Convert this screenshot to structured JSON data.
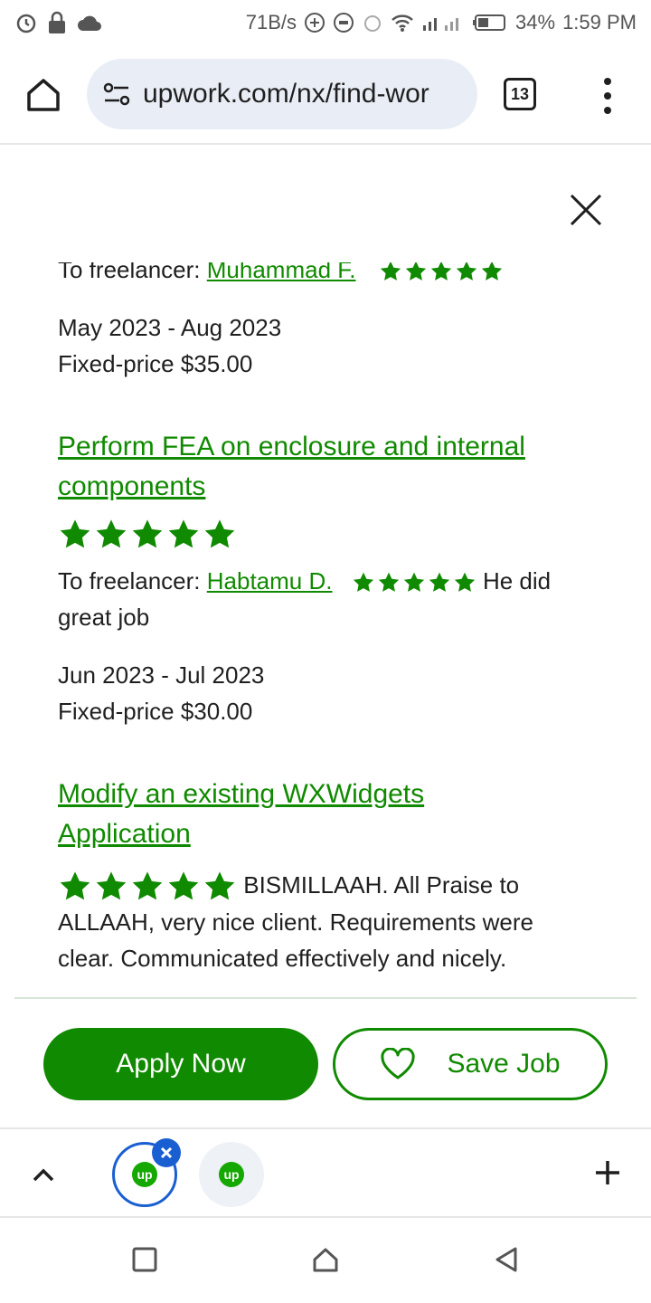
{
  "status_bar": {
    "speed": "71B/s",
    "battery": "34%",
    "time": "1:59 PM"
  },
  "browser": {
    "url": "upwork.com/nx/find-wor",
    "tab_count": "13"
  },
  "history": {
    "partial": {
      "to_freelancer_label": "To freelancer:",
      "freelancer": "Muhammad F.",
      "freelancer_rating": 5,
      "dates": "May 2023 - Aug 2023",
      "price": "Fixed-price $35.00"
    },
    "jobs": [
      {
        "title_line1": "Perform FEA on enclosure and internal",
        "title_line2": "components",
        "client_rating": 5,
        "to_freelancer_label": "To freelancer:",
        "freelancer": "Habtamu D.",
        "freelancer_rating": 5,
        "feedback_line1": "He did",
        "feedback_line2": "great job",
        "dates": "Jun 2023 - Jul 2023",
        "price": "Fixed-price $30.00"
      },
      {
        "title_line1": "Modify an existing WXWidgets",
        "title_line2": "Application",
        "client_rating": 5,
        "feedback_line1": "BISMILLAAH. All Praise to",
        "feedback_line2": "ALLAAH, very nice client. Requirements were",
        "feedback_line3": "clear. Communicated effectively and nicely."
      }
    ]
  },
  "actions": {
    "apply_label": "Apply Now",
    "save_label": "Save Job"
  },
  "tab_strip": {
    "favicon_text": "up"
  },
  "colors": {
    "brand_green": "#108a00",
    "tab_blue": "#1a5fd1"
  },
  "icons": [
    "alarm-icon",
    "lock-icon",
    "cloud-icon",
    "wifi-icon",
    "signal-icon",
    "battery-icon",
    "home-icon",
    "tune-icon",
    "more-vert-icon",
    "close-icon",
    "star-icon",
    "heart-icon",
    "chevron-up-icon",
    "plus-icon",
    "square-icon",
    "circle-home-icon",
    "back-icon"
  ]
}
